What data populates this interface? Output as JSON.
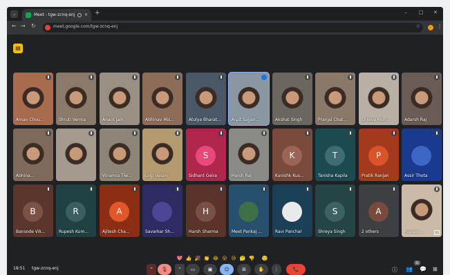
{
  "browser": {
    "tab_title": "Meet - tgw-zcnq-enj",
    "url": "meet.google.com/tgw-zcnq-enj",
    "new_tab_label": "+",
    "minimize": "–",
    "maximize": "□",
    "close": "✕"
  },
  "meeting": {
    "time": "18:51",
    "code": "tgw-zcnq-enj"
  },
  "participants": [
    {
      "name": "Aman Chou...",
      "kind": "video",
      "color": "#a86b4e"
    },
    {
      "name": "Shruti Verma",
      "kind": "video",
      "color": "#8b7a6a"
    },
    {
      "name": "Anant Jain",
      "kind": "video",
      "color": "#9a8f83"
    },
    {
      "name": "Abhinav Mis...",
      "kind": "video",
      "color": "#8d6c58"
    },
    {
      "name": "Atulya Bharat...",
      "kind": "video",
      "color": "#4a5766"
    },
    {
      "name": "Arpit Sajjan...",
      "kind": "video",
      "color": "#8a97a3",
      "speaking": true
    },
    {
      "name": "Akshat Singh",
      "kind": "video",
      "color": "#6b6660"
    },
    {
      "name": "Pranjal Chat...",
      "kind": "video",
      "color": "#8a7868"
    },
    {
      "name": "Shreya Moh...",
      "kind": "video",
      "color": "#b8b0a4"
    },
    {
      "name": "Adarsh Raj",
      "kind": "video",
      "color": "#6a5c55"
    },
    {
      "name": "Abhina...",
      "kind": "video",
      "color": "#7d6a5a"
    },
    {
      "name": "",
      "kind": "video",
      "color": "#a69a8f"
    },
    {
      "name": "Vinamra Tiw...",
      "kind": "video",
      "color": "#8c8578"
    },
    {
      "name": "Logi Vasan",
      "kind": "video",
      "color": "#b39a6f"
    },
    {
      "name": "Sidhant Geira",
      "kind": "avatar",
      "letter": "S",
      "tile": "#b0264d",
      "color": "#e8497a"
    },
    {
      "name": "Harsh Raj",
      "kind": "video",
      "color": "#8a8a86"
    },
    {
      "name": "Kanishk Kus...",
      "kind": "avatar",
      "letter": "K",
      "tile": "#7a4a3c",
      "color": "#9a6556"
    },
    {
      "name": "Tanisha Kapila",
      "kind": "avatar",
      "letter": "T",
      "tile": "#1d4a4f",
      "color": "#3d6d72"
    },
    {
      "name": "Pratik Ranjan",
      "kind": "avatar",
      "letter": "P",
      "tile": "#a23a1b",
      "color": "#d9542a"
    },
    {
      "name": "Assir Thota",
      "kind": "image",
      "tile": "#1a3a8f",
      "color": "#3d67c4"
    },
    {
      "name": "Bansode Vik...",
      "kind": "avatar",
      "letter": "B",
      "tile": "#5a362c",
      "color": "#7c5246"
    },
    {
      "name": "Rupesh Kum...",
      "kind": "avatar",
      "letter": "R",
      "tile": "#1f4143",
      "color": "#3b5f61"
    },
    {
      "name": "Ajitesh Cha...",
      "kind": "avatar",
      "letter": "A",
      "tile": "#8c2e14",
      "color": "#e0582a"
    },
    {
      "name": "Savarkar Sh...",
      "kind": "image",
      "tile": "#2e2b63",
      "color": "#4b4794"
    },
    {
      "name": "Harsh Sharma",
      "kind": "avatar",
      "letter": "H",
      "tile": "#5a342b",
      "color": "#7b5044"
    },
    {
      "name": "Meet Pankaj ...",
      "kind": "image",
      "tile": "#274f6e",
      "color": "#3e6f46"
    },
    {
      "name": "Ravi Panchal",
      "kind": "image",
      "tile": "#1b3f57",
      "color": "#e8eaed"
    },
    {
      "name": "Shreya Singh",
      "kind": "avatar",
      "letter": "S",
      "tile": "#244446",
      "color": "#3d6264"
    },
    {
      "name": "2 others",
      "kind": "others",
      "letter": "A",
      "tile": "#3c4043",
      "color": "#7a4a3c"
    },
    {
      "name": "Rishav ...",
      "kind": "video",
      "color": "#cbbba6"
    }
  ],
  "reactions": [
    "💖",
    "👍",
    "🎉",
    "👏",
    "😂",
    "😮",
    "😢",
    "🤔",
    "👎",
    "🙂"
  ],
  "controls": {
    "participant_count": "31",
    "end_call_icon": "📞"
  }
}
